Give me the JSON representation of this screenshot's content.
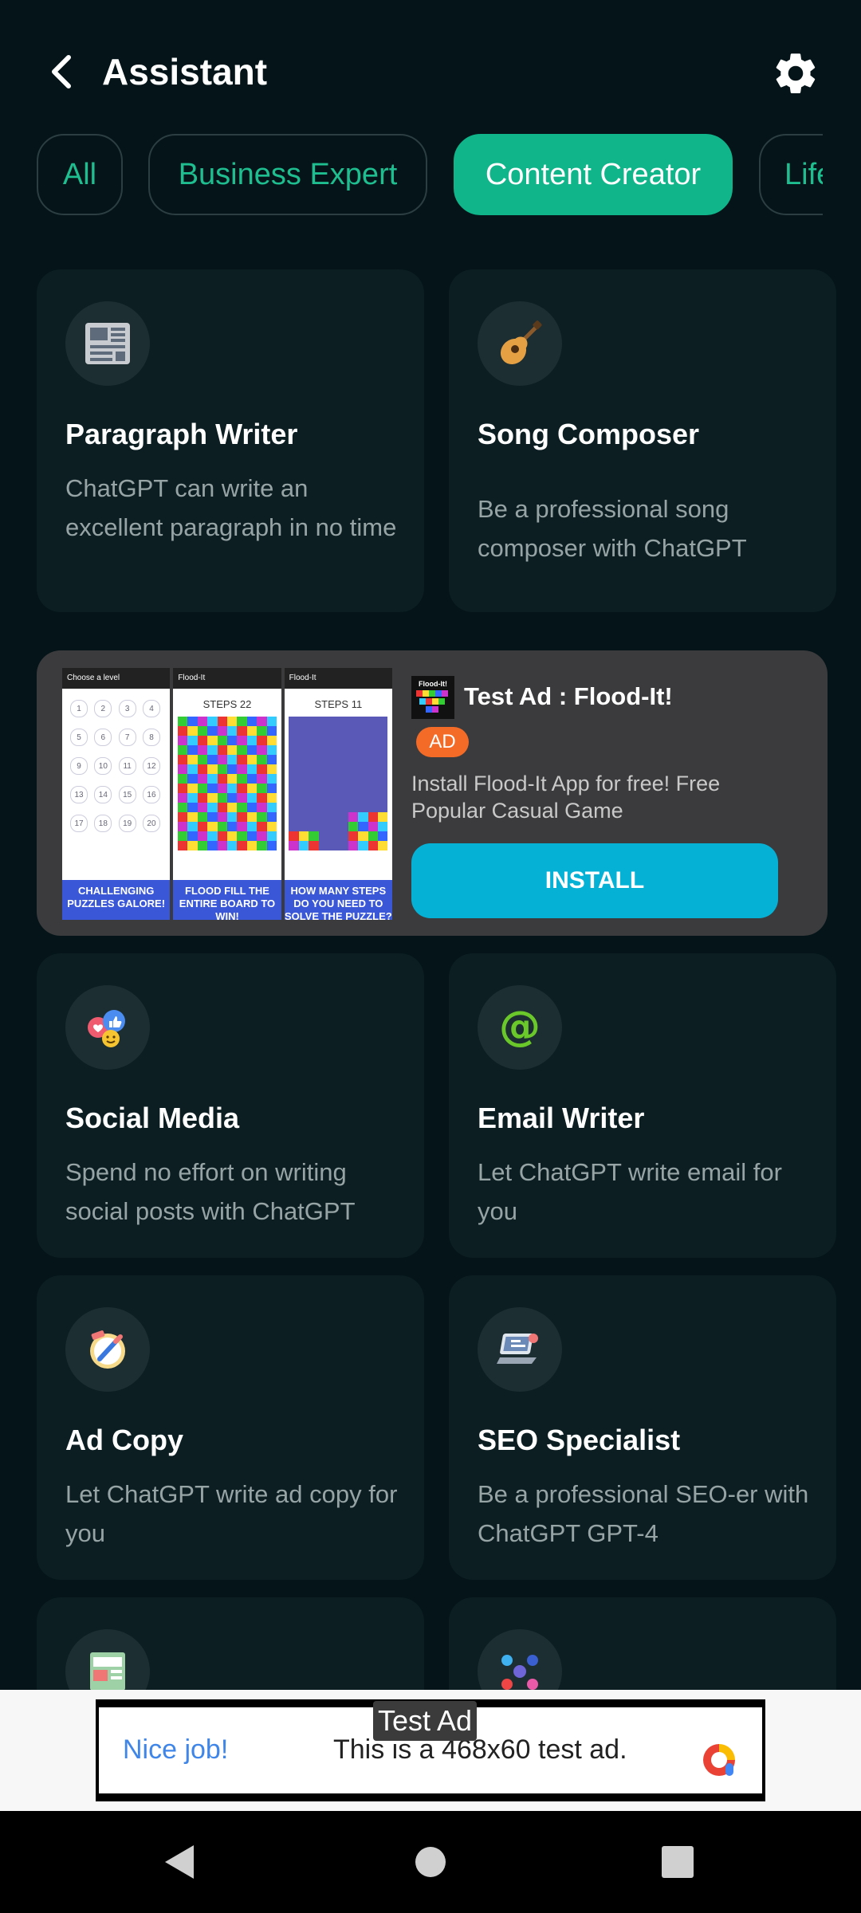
{
  "header": {
    "title": "Assistant"
  },
  "tabs": [
    {
      "label": "All"
    },
    {
      "label": "Business Expert"
    },
    {
      "label": "Content Creator"
    },
    {
      "label": "Life"
    }
  ],
  "cards": [
    {
      "title": "Paragraph Writer",
      "desc": "ChatGPT can write an excellent paragraph in no time",
      "icon": "newspaper-icon"
    },
    {
      "title": "Song Composer",
      "desc": "Be a professional song composer with ChatGPT",
      "icon": "guitar-icon"
    },
    {
      "title": "Social Media",
      "desc": "Spend no effort on writing social posts with ChatGPT",
      "icon": "social-reactions-icon"
    },
    {
      "title": "Email Writer",
      "desc": "Let ChatGPT write email for you",
      "icon": "at-sign-icon"
    },
    {
      "title": "Ad Copy",
      "desc": "Let ChatGPT write ad copy for you",
      "icon": "note-pencil-icon"
    },
    {
      "title": "SEO Specialist",
      "desc": "Be a professional SEO-er with ChatGPT  GPT-4",
      "icon": "laptop-icon"
    }
  ],
  "native_ad": {
    "title": "Test Ad : Flood-It!",
    "badge": "AD",
    "desc": "Install Flood-It App for free! Free Popular Casual Game",
    "install": "INSTALL",
    "icon_text": "Flood-It!",
    "shots": [
      {
        "bar": "Choose a level",
        "caption": "CHALLENGING PUZZLES GALORE!"
      },
      {
        "bar": "Flood-It",
        "steps": "STEPS 22",
        "caption": "FLOOD FILL THE ENTIRE BOARD TO WIN!"
      },
      {
        "bar": "Flood-It",
        "steps": "STEPS 11",
        "caption": "HOW MANY STEPS DO YOU NEED TO SOLVE THE PUZZLE?"
      }
    ],
    "levels": [
      "1",
      "2",
      "3",
      "4",
      "5",
      "6",
      "7",
      "8",
      "9",
      "10",
      "11",
      "12",
      "13",
      "14",
      "15",
      "16",
      "17",
      "18",
      "19",
      "20"
    ]
  },
  "banner_ad": {
    "label": "Test Ad",
    "nice": "Nice job!",
    "text": "This is a 468x60 test ad."
  },
  "colors": {
    "accent": "#10b58a",
    "background": "#041418",
    "card": "#0c1e22",
    "install": "#06b1d6",
    "ad_badge": "#f36b27"
  }
}
